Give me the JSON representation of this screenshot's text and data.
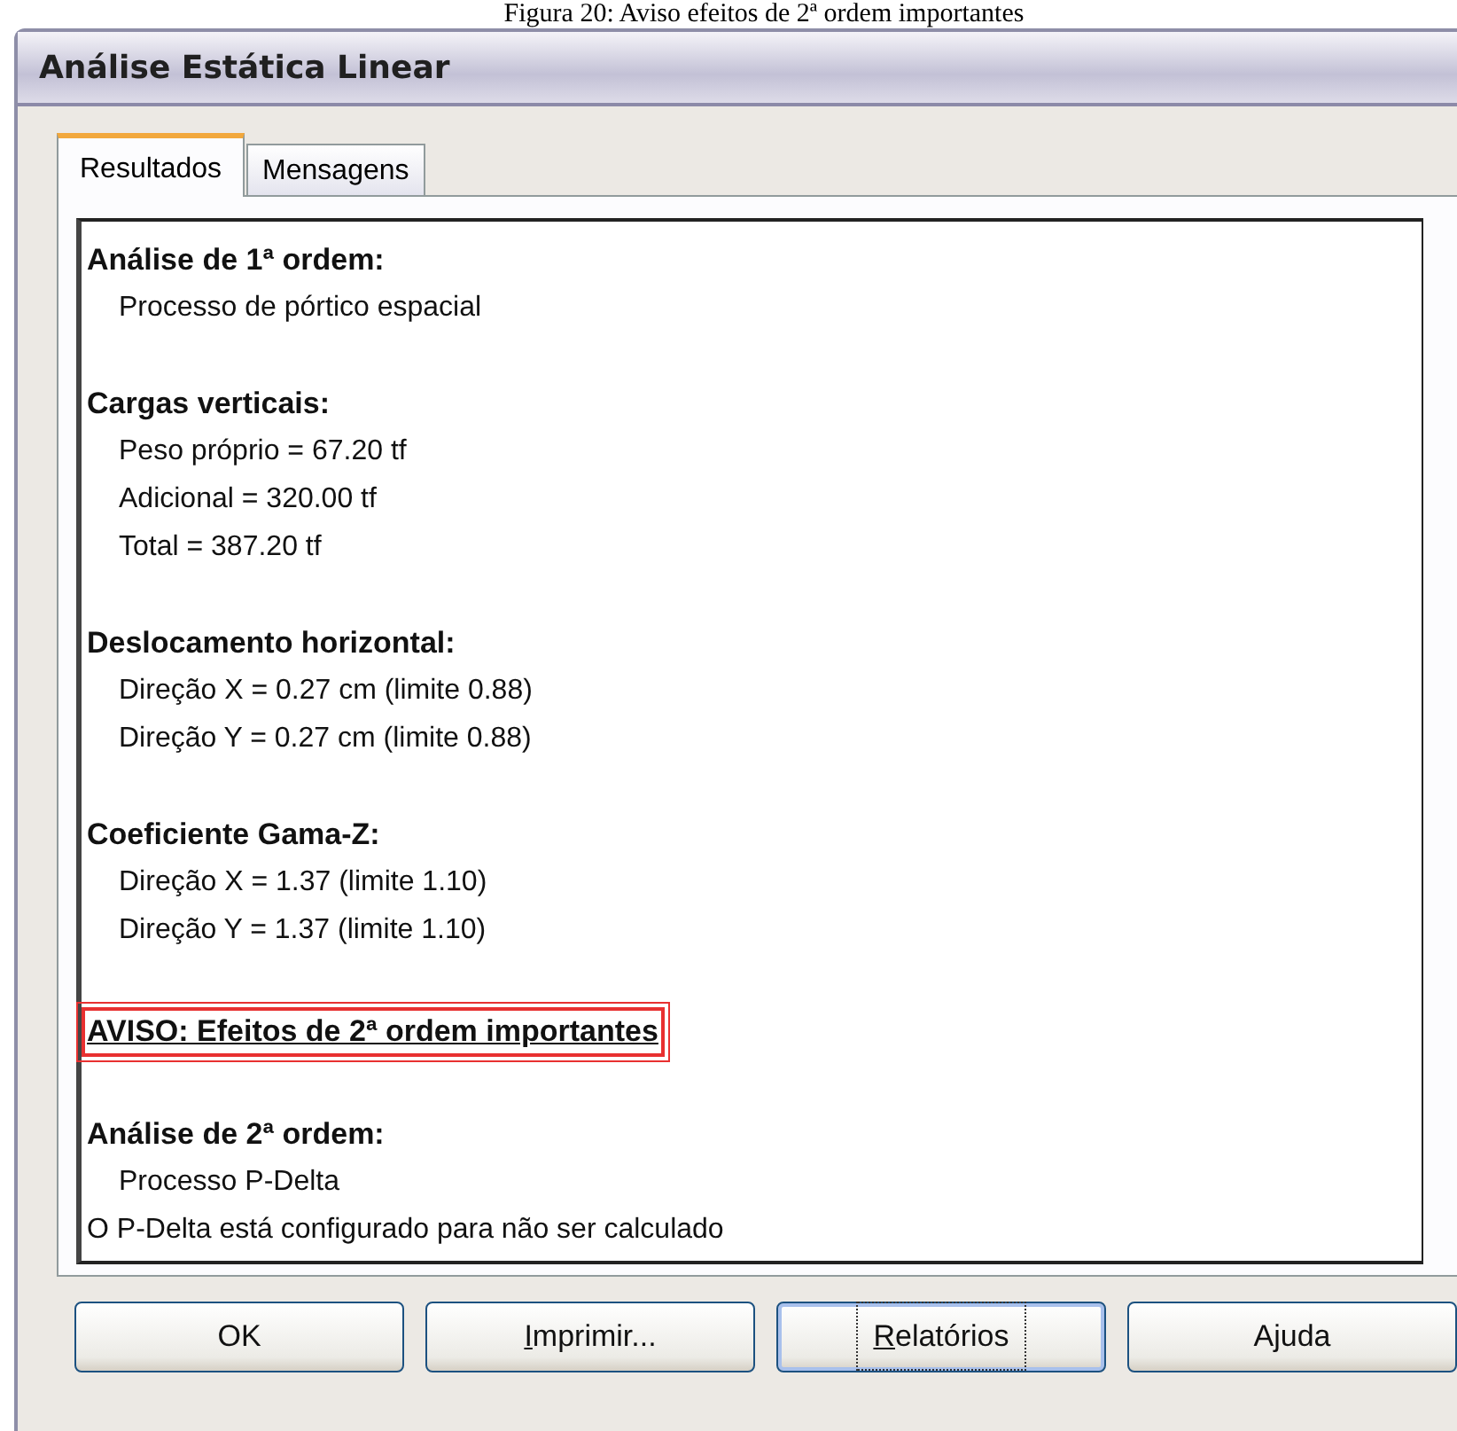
{
  "caption": "Figura 20: Aviso efeitos de 2ª ordem importantes",
  "window": {
    "title": "Análise Estática Linear"
  },
  "tabs": [
    {
      "label": "Resultados",
      "selected": true
    },
    {
      "label": "Mensagens",
      "selected": false
    }
  ],
  "sections": [
    {
      "kind": "group",
      "heading": "Análise de 1ª ordem:",
      "lines": [
        {
          "text": "Processo de pórtico espacial",
          "indented": true
        }
      ]
    },
    {
      "kind": "group",
      "heading": "Cargas verticais:",
      "lines": [
        {
          "text": "Peso próprio = 67.20 tf",
          "indented": true
        },
        {
          "text": "Adicional = 320.00 tf",
          "indented": true
        },
        {
          "text": "Total = 387.20 tf",
          "indented": true
        }
      ]
    },
    {
      "kind": "group",
      "heading": "Deslocamento horizontal:",
      "lines": [
        {
          "text": "Direção X = 0.27 cm (limite 0.88)",
          "indented": true
        },
        {
          "text": "Direção Y = 0.27 cm (limite 0.88)",
          "indented": true
        }
      ]
    },
    {
      "kind": "group",
      "heading": "Coeficiente Gama-Z:",
      "lines": [
        {
          "text": "Direção X = 1.37 (limite 1.10)",
          "indented": true
        },
        {
          "text": "Direção Y = 1.37 (limite 1.10)",
          "indented": true
        }
      ]
    },
    {
      "kind": "warning",
      "heading": "AVISO: Efeitos de 2ª ordem importantes"
    },
    {
      "kind": "group",
      "heading": "Análise de 2ª ordem:",
      "lines": [
        {
          "text": "Processo P-Delta",
          "indented": true
        },
        {
          "text": "O P-Delta está configurado para não ser calculado",
          "indented": false
        }
      ]
    }
  ],
  "buttons": [
    {
      "label": "OK",
      "mnemonic_underlined": false,
      "focused": false
    },
    {
      "label": "Imprimir...",
      "mnemonic_underlined": true,
      "focused": false
    },
    {
      "label": "Relatórios",
      "mnemonic_underlined": true,
      "focused": true
    },
    {
      "label": "Ajuda",
      "mnemonic_underlined": false,
      "focused": false
    }
  ]
}
